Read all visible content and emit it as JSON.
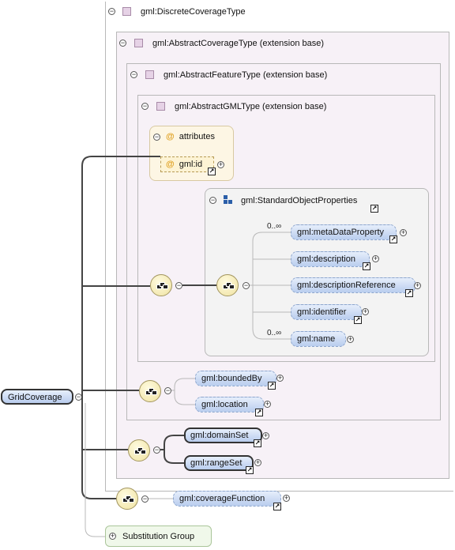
{
  "root_element": {
    "label": "GridCoverage"
  },
  "types": {
    "discrete": "gml:DiscreteCoverageType",
    "abstract_coverage": "gml:AbstractCoverageType (extension base)",
    "abstract_feature": "gml:AbstractFeatureType (extension base)",
    "abstract_gml": "gml:AbstractGMLType (extension base)"
  },
  "attributes": {
    "header": "attributes",
    "id_label": "gml:id"
  },
  "standard_object_properties": {
    "header": "gml:StandardObjectProperties",
    "elements": [
      {
        "label": "gml:metaDataProperty",
        "cardinality": "0..∞"
      },
      {
        "label": "gml:description",
        "cardinality": ""
      },
      {
        "label": "gml:descriptionReference",
        "cardinality": ""
      },
      {
        "label": "gml:identifier",
        "cardinality": ""
      },
      {
        "label": "gml:name",
        "cardinality": "0..∞"
      }
    ]
  },
  "coverage_elements": {
    "bounded_by": "gml:boundedBy",
    "location": "gml:location"
  },
  "discrete_elements": {
    "domain_set": "gml:domainSet",
    "range_set": "gml:rangeSet"
  },
  "coverage_function": "gml:coverageFunction",
  "substitution_group": "Substitution Group",
  "colors": {
    "element_fill": "#b9cdee",
    "type_fill": "#f7f1f7",
    "attribute_fill": "#fdf6e4",
    "connector": "#444444"
  }
}
